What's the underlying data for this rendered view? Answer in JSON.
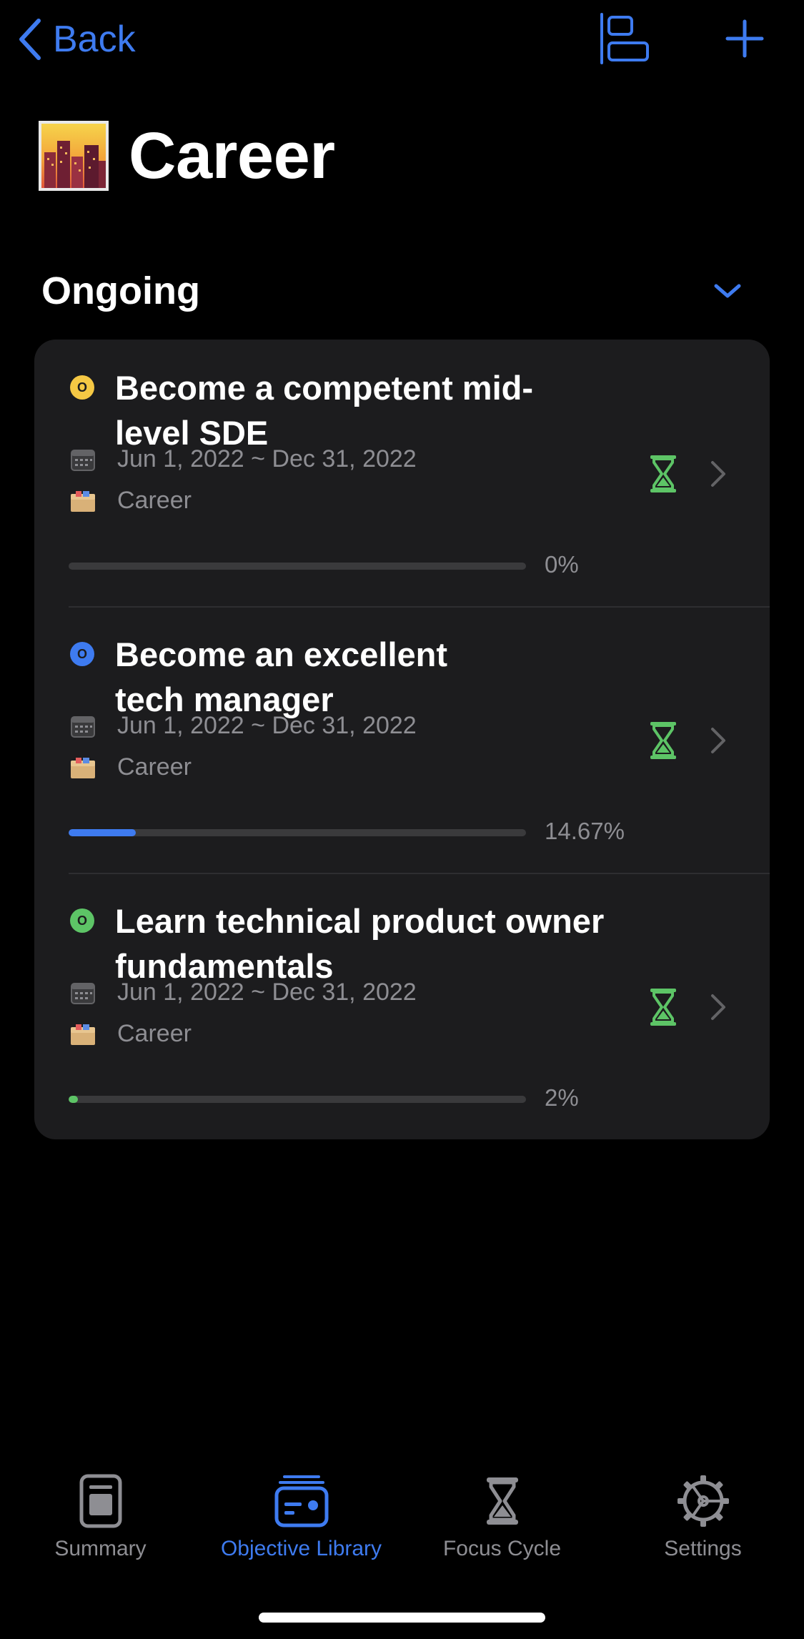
{
  "nav": {
    "back_label": "Back",
    "back_icon": "chevron-left-icon",
    "layout_icon": "align-left-layout-icon",
    "add_icon": "plus-icon",
    "accent_color": "#3E7BF0"
  },
  "page": {
    "title": "Career",
    "title_emoji": "city-sunset-emoji"
  },
  "section": {
    "title": "Ongoing",
    "toggle_icon": "chevron-down-icon"
  },
  "objectives": [
    {
      "status_letter": "O",
      "status_color": "#F5C844",
      "title": "Become a competent mid-level SDE",
      "title_line1": "Become a competent mid-",
      "title_line2": "level SDE",
      "dates": "Jun 1, 2022 ~ Dec 31, 2022",
      "category": "Career",
      "progress_percent": 0,
      "progress_label": "0%",
      "progress_color": "#3A3A3C"
    },
    {
      "status_letter": "O",
      "status_color": "#3E7BF0",
      "title": "Become an excellent tech manager",
      "title_line1": "Become an excellent",
      "title_line2": "tech manager",
      "dates": "Jun 1, 2022 ~ Dec 31, 2022",
      "category": "Career",
      "progress_percent": 14.67,
      "progress_label": "14.67%",
      "progress_color": "#3E7BF0"
    },
    {
      "status_letter": "O",
      "status_color": "#5DC466",
      "title": "Learn technical product owner fundamentals",
      "title_line1": "Learn technical product owner",
      "title_line2": "fundamentals",
      "dates": "Jun 1, 2022 ~ Dec 31, 2022",
      "category": "Career",
      "progress_percent": 2,
      "progress_label": "2%",
      "progress_color": "#5DC466"
    }
  ],
  "tabbar": {
    "tabs": [
      {
        "label": "Summary",
        "icon": "summary-doc-icon",
        "active": false
      },
      {
        "label": "Objective Library",
        "icon": "objective-library-icon",
        "active": true
      },
      {
        "label": "Focus Cycle",
        "icon": "hourglass-icon",
        "active": false
      },
      {
        "label": "Settings",
        "icon": "gear-icon",
        "active": false
      }
    ],
    "active_color": "#3E7BF0",
    "inactive_color": "#8E8E93"
  },
  "colors": {
    "background": "#000000",
    "card": "#1C1C1E",
    "secondary_text": "#8E8E93",
    "timer_green": "#5DC466"
  }
}
